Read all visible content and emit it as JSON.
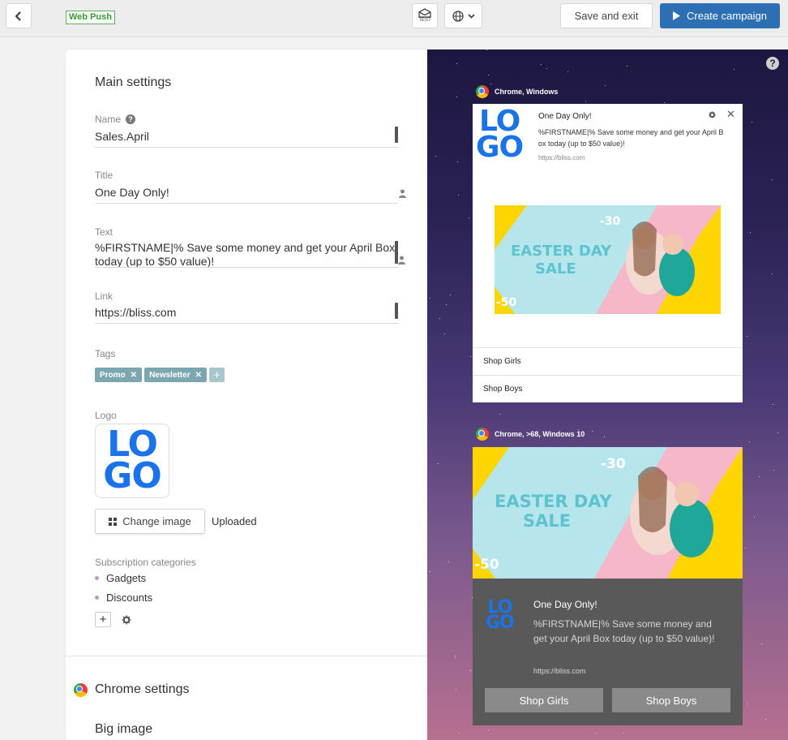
{
  "header": {
    "channel_badge": "Web Push",
    "test_label": "TEST",
    "save_exit_label": "Save and exit",
    "create_label": "Create campaign"
  },
  "main": {
    "section_title": "Main settings",
    "name": {
      "label": "Name",
      "value": "Sales.April"
    },
    "title": {
      "label": "Title",
      "value": "One Day Only!"
    },
    "text": {
      "label": "Text",
      "value": "%FIRSTNAME|% Save some money and get your April Box today (up to $50 value)!"
    },
    "link": {
      "label": "Link",
      "value": "https://bliss.com"
    },
    "tags": {
      "label": "Tags",
      "items": [
        "Promo",
        "Newsletter"
      ]
    },
    "logo": {
      "label": "Logo",
      "line1": "LO",
      "line2": "GO"
    },
    "change_image_label": "Change image",
    "upload_status": "Uploaded",
    "subscription": {
      "label": "Subscription categories",
      "items": [
        "Gadgets",
        "Discounts"
      ]
    },
    "chrome_settings_title": "Chrome settings",
    "big_image_label": "Big image"
  },
  "preview": {
    "help": "?",
    "notif1": {
      "browser": "Chrome, Windows",
      "title": "One Day Only!",
      "text": "%FIRSTNAME|% Save some money and get your April Box today (up to $50 value)!",
      "url": "https://bliss.com",
      "buttons": [
        "Shop Girls",
        "Shop Boys"
      ]
    },
    "notif2": {
      "browser": "Chrome, >68, Windows 10",
      "title": "One Day Only!",
      "text": "%FIRSTNAME|% Save some money and get your April Box today (up to $50 value)!",
      "url": "https://bliss.com",
      "buttons": [
        "Shop Girls",
        "Shop Boys"
      ]
    },
    "banner": {
      "line1": "EASTER DAY",
      "line2": "SALE",
      "badge1": "-30",
      "badge2": "-50"
    }
  },
  "colors": {
    "accent": "#2c6fb3",
    "logo_blue": "#1a73e8",
    "tag_bg": "#7ca6b0",
    "badge_green": "#3f9a3f"
  }
}
